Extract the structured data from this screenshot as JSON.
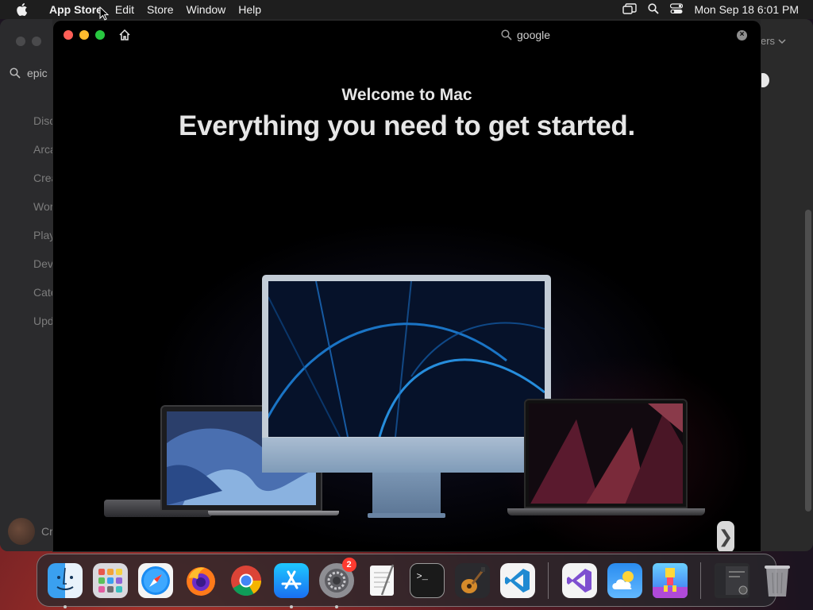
{
  "menubar": {
    "app_name": "App Store",
    "items": [
      "Edit",
      "Store",
      "Window",
      "Help"
    ],
    "clock": "Mon Sep 18  6:01 PM"
  },
  "background_window": {
    "search_value": "epic",
    "sidebar_items": [
      "Discover",
      "Arcade",
      "Create",
      "Work",
      "Play",
      "Develop",
      "Categories",
      "Updates"
    ],
    "account_label": "Cr",
    "filter_label": "ers"
  },
  "welcome": {
    "search_value": "google",
    "subtitle": "Welcome to Mac",
    "title": "Everything you need to get started.",
    "next_glyph": "❯"
  },
  "dock": {
    "items": [
      {
        "name": "finder-icon",
        "running": true
      },
      {
        "name": "launchpad-icon",
        "running": false
      },
      {
        "name": "safari-icon",
        "running": false
      },
      {
        "name": "firefox-icon",
        "running": false
      },
      {
        "name": "chrome-icon",
        "running": false
      },
      {
        "name": "app-store-icon",
        "running": true
      },
      {
        "name": "system-settings-icon",
        "running": true,
        "badge": "2"
      },
      {
        "name": "textedit-icon",
        "running": false
      },
      {
        "name": "terminal-icon",
        "running": false
      },
      {
        "name": "garageband-icon",
        "running": false
      },
      {
        "name": "vscode-icon",
        "running": false
      }
    ],
    "terminal_prompt": ">_"
  },
  "colors": {
    "close": "#ff5f57",
    "minimize": "#febc2e",
    "zoom": "#28c840",
    "badge": "#ff3b30"
  }
}
